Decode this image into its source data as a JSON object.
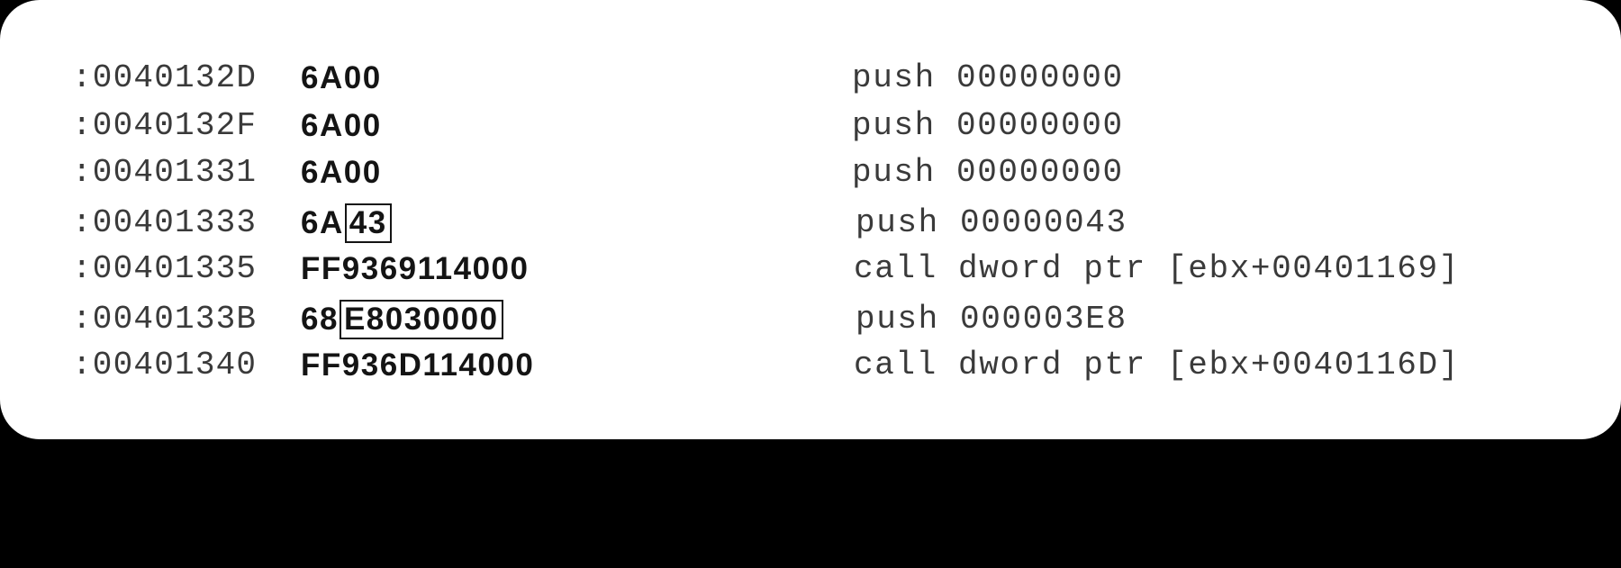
{
  "disassembly": [
    {
      "address": ":0040132D",
      "opcode": "6A",
      "operand_bytes": "00",
      "operand_boxed": false,
      "instruction": "push 00000000"
    },
    {
      "address": ":0040132F",
      "opcode": "6A",
      "operand_bytes": "00",
      "operand_boxed": false,
      "instruction": "push 00000000"
    },
    {
      "address": ":00401331",
      "opcode": "6A",
      "operand_bytes": "00",
      "operand_boxed": false,
      "instruction": "push 00000000"
    },
    {
      "address": ":00401333",
      "opcode": "6A",
      "operand_bytes": "43",
      "operand_boxed": true,
      "instruction": "push 00000043"
    },
    {
      "address": ":00401335",
      "opcode": "FF9369114000",
      "operand_bytes": "",
      "operand_boxed": false,
      "instruction": "call dword ptr [ebx+00401169]"
    },
    {
      "address": ":0040133B",
      "opcode": "68",
      "operand_bytes": "E8030000",
      "operand_boxed": true,
      "instruction": "push 000003E8"
    },
    {
      "address": ":00401340",
      "opcode": "FF936D114000",
      "operand_bytes": "",
      "operand_boxed": false,
      "instruction": "call dword ptr [ebx+0040116D]"
    }
  ]
}
